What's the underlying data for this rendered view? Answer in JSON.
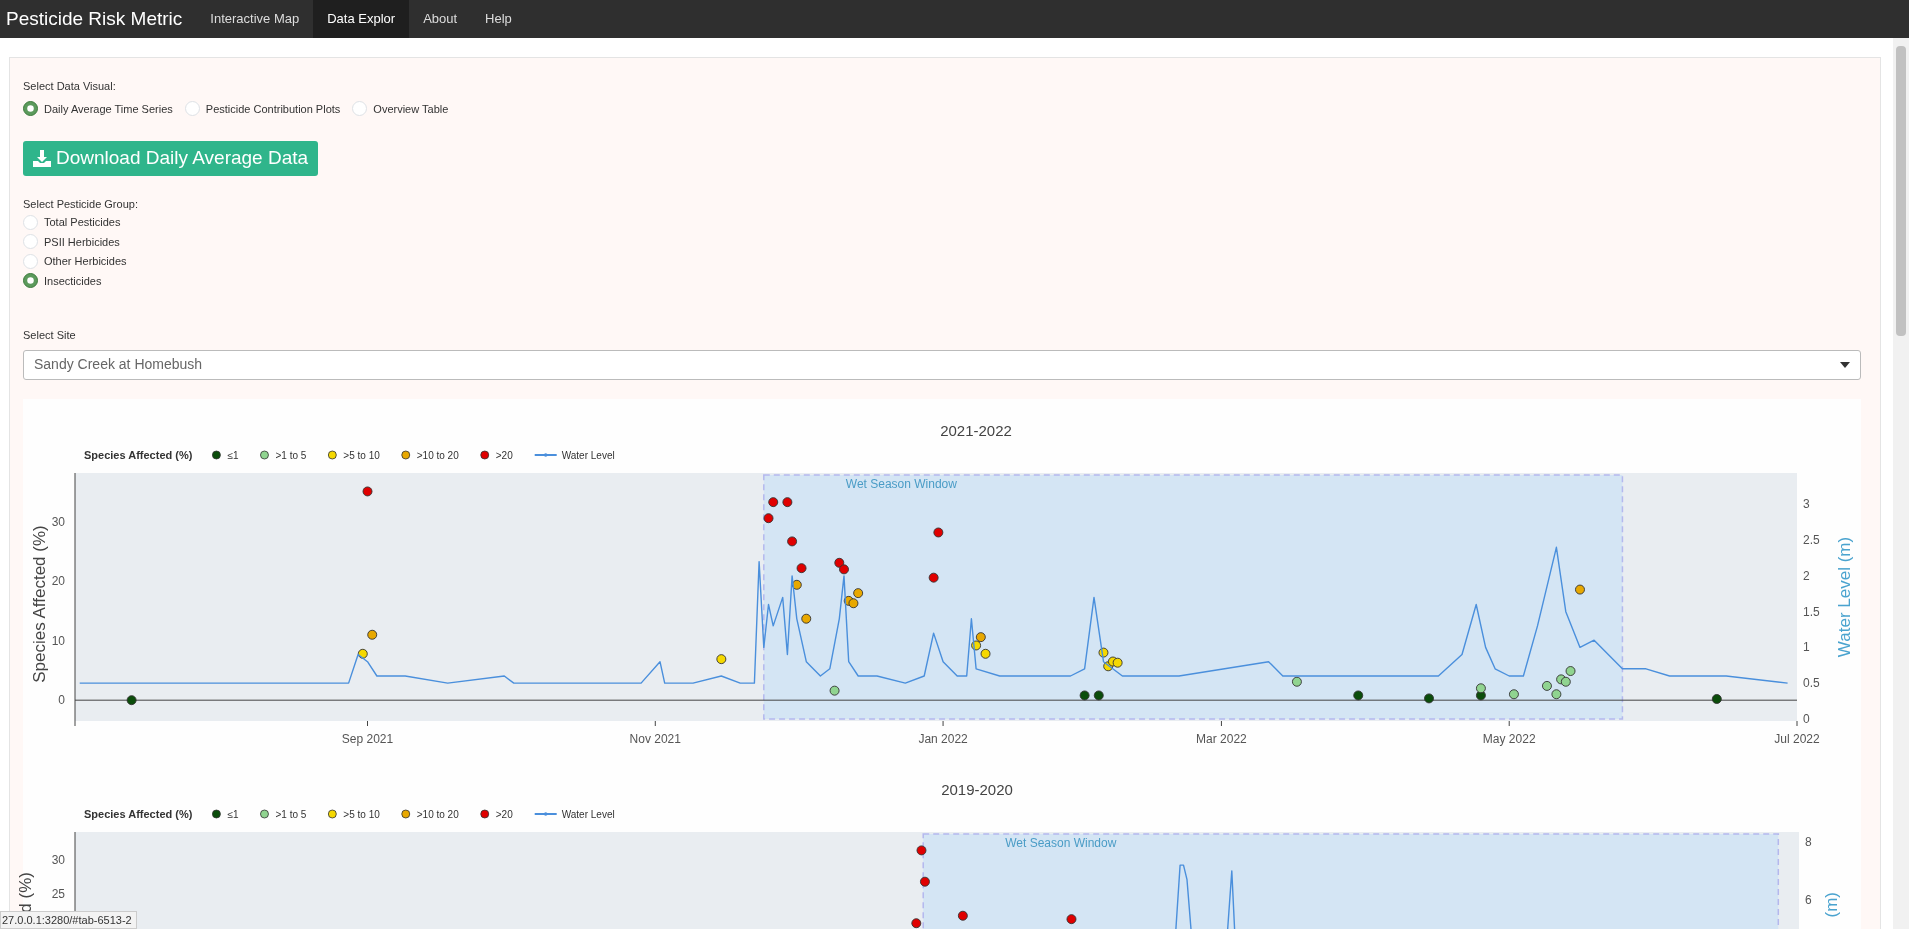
{
  "navbar": {
    "brand": "Pesticide Risk Metric",
    "items": [
      {
        "label": "Interactive Map",
        "selected": false
      },
      {
        "label": "Data Explor",
        "selected": true
      },
      {
        "label": "About",
        "selected": false
      },
      {
        "label": "Help",
        "selected": false
      }
    ]
  },
  "data_visual": {
    "label": "Select Data Visual:",
    "options": [
      {
        "label": "Daily Average Time Series",
        "selected": true
      },
      {
        "label": "Pesticide Contribution Plots",
        "selected": false
      },
      {
        "label": "Overview Table",
        "selected": false
      }
    ]
  },
  "download_button": {
    "label": "Download Daily Average Data"
  },
  "pesticide_group": {
    "label": "Select Pesticide Group:",
    "options": [
      {
        "label": "Total Pesticides",
        "selected": false
      },
      {
        "label": "PSII Herbicides",
        "selected": false
      },
      {
        "label": "Other Herbicides",
        "selected": false
      },
      {
        "label": "Insecticides",
        "selected": true
      }
    ]
  },
  "site": {
    "label": "Select Site",
    "value": "Sandy Creek at Homebush"
  },
  "charts": [
    {
      "chart_data": {
        "type": "scatter",
        "title": "2021-2022",
        "legend": "top",
        "legend_title": "Species Affected (%)",
        "ylabel": "Species Affected (%)",
        "y2label": "Water Level (m)",
        "xlim": [
          "2021-07-01",
          "2022-07-01"
        ],
        "ylim": [
          -3.5,
          38.2
        ],
        "y2lim": [
          -0.03,
          3.44
        ],
        "xticks": [
          {
            "value": "2021-09-01",
            "label": "Sep 2021"
          },
          {
            "value": "2021-11-01",
            "label": "Nov 2021"
          },
          {
            "value": "2022-01-01",
            "label": "Jan 2022"
          },
          {
            "value": "2022-03-01",
            "label": "Mar 2022"
          },
          {
            "value": "2022-05-01",
            "label": "May 2022"
          },
          {
            "value": "2022-07-01",
            "label": "Jul 2022"
          }
        ],
        "yticks": [
          0,
          10,
          20,
          30
        ],
        "y2ticks": [
          0,
          0.5,
          1,
          1.5,
          2,
          2.5,
          3
        ],
        "series": [
          {
            "name": "≤1",
            "color": "#0b4d0b",
            "x": [
              "2021-07-13",
              "2022-01-31",
              "2022-02-03",
              "2022-03-30",
              "2022-04-14",
              "2022-04-25",
              "2022-06-14"
            ],
            "values": [
              0,
              0.8,
              0.8,
              0.8,
              0.3,
              0.8,
              0.2
            ]
          },
          {
            "name": ">1 to 5",
            "color": "#90d490",
            "x": [
              "2021-12-09",
              "2022-03-17",
              "2022-04-25",
              "2022-05-02",
              "2022-05-09",
              "2022-05-11",
              "2022-05-12",
              "2022-05-13",
              "2022-05-14"
            ],
            "values": [
              1.6,
              3.1,
              2.0,
              1.0,
              2.4,
              1.0,
              3.5,
              3.1,
              4.9
            ]
          },
          {
            "name": ">5 to 10",
            "color": "#f5d800",
            "x": [
              "2021-08-31",
              "2021-11-15",
              "2022-01-08",
              "2022-01-10",
              "2022-02-04",
              "2022-02-05",
              "2022-02-06",
              "2022-02-07"
            ],
            "values": [
              7.8,
              6.9,
              9.2,
              7.8,
              8.0,
              5.7,
              6.5,
              6.3
            ]
          },
          {
            "name": ">10 to 20",
            "color": "#e8a800",
            "x": [
              "2021-09-02",
              "2021-12-01",
              "2021-12-03",
              "2021-12-12",
              "2021-12-13",
              "2021-12-14",
              "2022-01-09",
              "2022-05-16"
            ],
            "values": [
              11.0,
              19.4,
              13.7,
              16.7,
              16.3,
              18.0,
              10.6,
              18.6
            ]
          },
          {
            "name": ">20",
            "color": "#e00000",
            "x": [
              "2021-09-01",
              "2021-11-25",
              "2021-11-26",
              "2021-11-29",
              "2021-11-30",
              "2021-12-02",
              "2021-12-10",
              "2021-12-11",
              "2021-12-30",
              "2021-12-31"
            ],
            "values": [
              35.1,
              30.6,
              33.3,
              33.3,
              26.7,
              22.2,
              23.1,
              22.0,
              20.6,
              28.2
            ]
          },
          {
            "name": "Water Level",
            "type": "line",
            "axis": "y2",
            "color": "#4a8fdc",
            "x": [
              "2021-07-02",
              "2021-07-16",
              "2021-07-31",
              "2021-08-16",
              "2021-08-28",
              "2021-08-30",
              "2021-09-01",
              "2021-09-03",
              "2021-09-09",
              "2021-09-18",
              "2021-09-30",
              "2021-10-02",
              "2021-10-15",
              "2021-10-29",
              "2021-11-02",
              "2021-11-03",
              "2021-11-09",
              "2021-11-15",
              "2021-11-19",
              "2021-11-22",
              "2021-11-23",
              "2021-11-24",
              "2021-11-25",
              "2021-11-26",
              "2021-11-28",
              "2021-11-29",
              "2021-11-30",
              "2021-12-01",
              "2021-12-03",
              "2021-12-06",
              "2021-12-08",
              "2021-12-10",
              "2021-12-11",
              "2021-12-12",
              "2021-12-14",
              "2021-12-18",
              "2021-12-24",
              "2021-12-28",
              "2021-12-30",
              "2022-01-01",
              "2022-01-04",
              "2022-01-06",
              "2022-01-07",
              "2022-01-08",
              "2022-01-13",
              "2022-01-28",
              "2022-01-31",
              "2022-02-02",
              "2022-02-04",
              "2022-02-08",
              "2022-02-20",
              "2022-03-11",
              "2022-03-14",
              "2022-04-01",
              "2022-04-16",
              "2022-04-21",
              "2022-04-24",
              "2022-04-26",
              "2022-04-28",
              "2022-05-01",
              "2022-05-04",
              "2022-05-07",
              "2022-05-11",
              "2022-05-13",
              "2022-05-16",
              "2022-05-19",
              "2022-05-25",
              "2022-05-30",
              "2022-06-04",
              "2022-06-16",
              "2022-06-29"
            ],
            "values": [
              0.5,
              0.5,
              0.5,
              0.5,
              0.5,
              0.9,
              0.8,
              0.6,
              0.6,
              0.5,
              0.6,
              0.5,
              0.5,
              0.5,
              0.8,
              0.5,
              0.5,
              0.6,
              0.5,
              0.5,
              2.2,
              1.0,
              1.6,
              1.3,
              1.7,
              0.9,
              2.0,
              1.4,
              0.8,
              0.6,
              0.7,
              1.4,
              2.0,
              0.8,
              0.6,
              0.6,
              0.5,
              0.6,
              1.2,
              0.8,
              0.6,
              0.6,
              1.4,
              0.7,
              0.6,
              0.6,
              0.7,
              1.7,
              0.8,
              0.6,
              0.6,
              0.8,
              0.6,
              0.6,
              0.6,
              0.9,
              1.6,
              1.0,
              0.7,
              0.6,
              0.6,
              1.3,
              2.4,
              1.5,
              1.0,
              1.1,
              0.7,
              0.7,
              0.6,
              0.6,
              0.5
            ]
          }
        ],
        "bands": [
          {
            "axis": "x",
            "from": "2021-11-24",
            "to": "2022-05-25",
            "label": "Wet Season Window"
          }
        ]
      }
    },
    {
      "title": "2019-2020",
      "legend_title": "Species Affected (%)",
      "ylabel": "d (%)",
      "y2label": "(m)",
      "yticks": [
        "30",
        "25"
      ],
      "y2ticks": [
        "8",
        "6"
      ],
      "legend_items": [
        {
          "name": "≤1",
          "kind": "marker",
          "color": "#0b4d0b"
        },
        {
          "name": ">1 to 5",
          "kind": "marker",
          "color": "#90d490"
        },
        {
          "name": ">5 to 10",
          "kind": "marker",
          "color": "#f5d800"
        },
        {
          "name": ">10 to 20",
          "kind": "marker",
          "color": "#e8a800"
        },
        {
          "name": ">20",
          "kind": "marker",
          "color": "#e00000"
        },
        {
          "name": "Water Level",
          "kind": "line",
          "color": "#4a8fdc"
        }
      ],
      "band_label": "Wet Season Window"
    }
  ],
  "status_tooltip": "27.0.0.1:3280/#tab-6513-2"
}
